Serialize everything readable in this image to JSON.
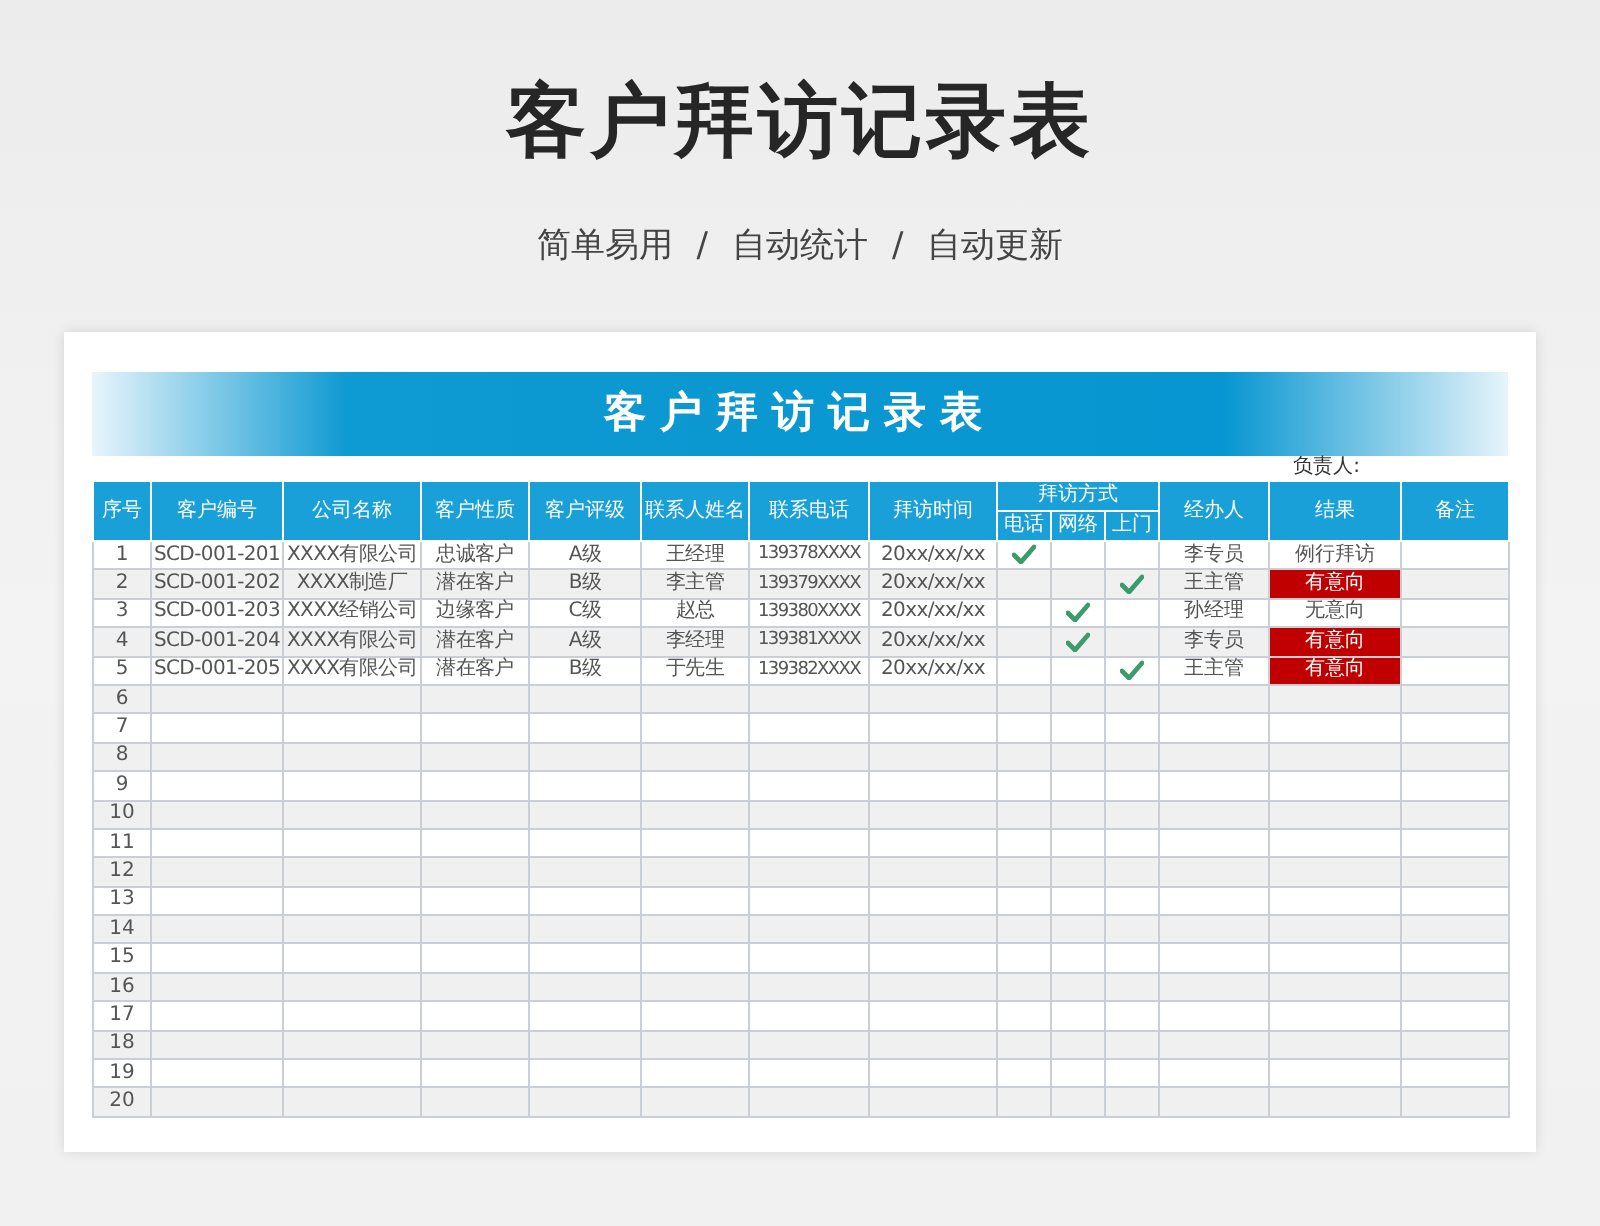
{
  "page_title": "客户拜访记录表",
  "taglines": [
    "简单易用",
    "自动统计",
    "自动更新"
  ],
  "tagline_separator": "/",
  "sheet": {
    "banner": "客户拜访记录表",
    "owner_label": "负责人:",
    "columns": [
      {
        "label": "序号"
      },
      {
        "label": "客户编号"
      },
      {
        "label": "公司名称"
      },
      {
        "label": "客户性质"
      },
      {
        "label": "客户评级"
      },
      {
        "label": "联系人姓名"
      },
      {
        "label": "联系电话"
      },
      {
        "label": "拜访时间"
      },
      {
        "label": "拜访方式",
        "children": [
          {
            "label": "电话"
          },
          {
            "label": "网络"
          },
          {
            "label": "上门"
          }
        ]
      },
      {
        "label": "经办人"
      },
      {
        "label": "结果"
      },
      {
        "label": "备注"
      }
    ],
    "rows": [
      {
        "no": "1",
        "id": "SCD-001-201",
        "company": "XXXX有限公司",
        "type": "忠诚客户",
        "grade": "A级",
        "contact": "王经理",
        "phone": "139378XXXX",
        "date": "20xx/xx/xx",
        "methods": [
          true,
          false,
          false
        ],
        "handler": "李专员",
        "result": {
          "text": "例行拜访",
          "highlight": false
        }
      },
      {
        "no": "2",
        "id": "SCD-001-202",
        "company": "XXXX制造厂",
        "type": "潜在客户",
        "grade": "B级",
        "contact": "李主管",
        "phone": "139379XXXX",
        "date": "20xx/xx/xx",
        "methods": [
          false,
          false,
          true
        ],
        "handler": "王主管",
        "result": {
          "text": "有意向",
          "highlight": true
        }
      },
      {
        "no": "3",
        "id": "SCD-001-203",
        "company": "XXXX经销公司",
        "type": "边缘客户",
        "grade": "C级",
        "contact": "赵总",
        "phone": "139380XXXX",
        "date": "20xx/xx/xx",
        "methods": [
          false,
          true,
          false
        ],
        "handler": "孙经理",
        "result": {
          "text": "无意向",
          "highlight": false
        }
      },
      {
        "no": "4",
        "id": "SCD-001-204",
        "company": "XXXX有限公司",
        "type": "潜在客户",
        "grade": "A级",
        "contact": "李经理",
        "phone": "139381XXXX",
        "date": "20xx/xx/xx",
        "methods": [
          false,
          true,
          false
        ],
        "handler": "李专员",
        "result": {
          "text": "有意向",
          "highlight": true
        }
      },
      {
        "no": "5",
        "id": "SCD-001-205",
        "company": "XXXX有限公司",
        "type": "潜在客户",
        "grade": "B级",
        "contact": "于先生",
        "phone": "139382XXXX",
        "date": "20xx/xx/xx",
        "methods": [
          false,
          false,
          true
        ],
        "handler": "王主管",
        "result": {
          "text": "有意向",
          "highlight": true
        }
      },
      {
        "no": "6"
      },
      {
        "no": "7"
      },
      {
        "no": "8"
      },
      {
        "no": "9"
      },
      {
        "no": "10"
      },
      {
        "no": "11"
      },
      {
        "no": "12"
      },
      {
        "no": "13"
      },
      {
        "no": "14"
      },
      {
        "no": "15"
      },
      {
        "no": "16"
      },
      {
        "no": "17"
      },
      {
        "no": "18"
      },
      {
        "no": "19"
      },
      {
        "no": "20"
      }
    ]
  }
}
